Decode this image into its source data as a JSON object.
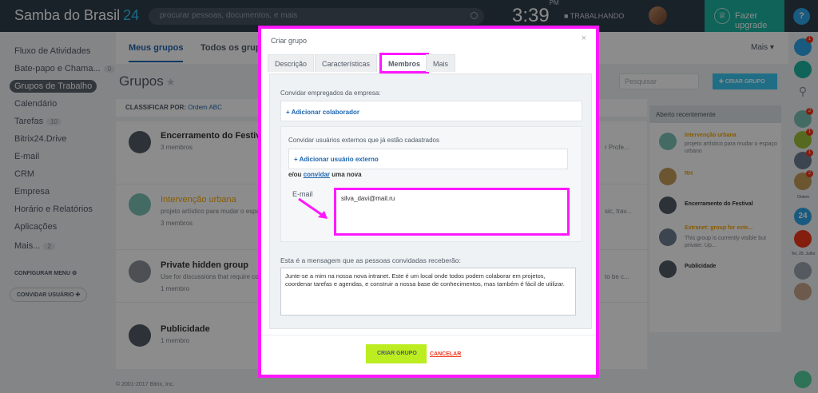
{
  "header": {
    "logo": "Samba do Brasil",
    "logo_number": "24",
    "search_placeholder": "procurar pessoas, documentos, e mais",
    "time": "3:39",
    "time_suffix": "PM",
    "work_status": "TRABALHANDO",
    "upgrade_label": "Fazer upgrade",
    "help": "?"
  },
  "sidebar": {
    "items": [
      {
        "label": "Fluxo de Atividades"
      },
      {
        "label": "Bate-papo e Chama...",
        "count": "0"
      },
      {
        "label": "Grupos de Trabalho"
      },
      {
        "label": "Calendário"
      },
      {
        "label": "Tarefas",
        "count": "10"
      },
      {
        "label": "Bitrix24.Drive"
      },
      {
        "label": "E-mail"
      },
      {
        "label": "CRM"
      },
      {
        "label": "Empresa"
      },
      {
        "label": "Horário e Relatórios"
      },
      {
        "label": "Aplicações"
      },
      {
        "label": "Mais...",
        "count": "2"
      }
    ],
    "configure_menu": "CONFIGURAR MENU",
    "invite_user": "CONVIDAR USUÁRIO"
  },
  "main": {
    "tabs": [
      "Meus grupos",
      "Todos os grupos"
    ],
    "more": "Mais",
    "title": "Grupos",
    "search_placeholder": "Pesquisar",
    "create_group": "CRIAR GRUPO",
    "sort_label": "CLASSIFICAR POR:",
    "sort_value": "Ordem ABC",
    "groups": [
      {
        "name": "Encerramento do Festival",
        "desc": "",
        "meta": "3 membros",
        "trail": "r Profe..."
      },
      {
        "name": "Intervenção urbana",
        "desc": "projeto artístico para mudar o espa",
        "meta": "3 membros",
        "trail": "sic, trav..."
      },
      {
        "name": "Private hidden group",
        "desc": "Use for discussions that require co",
        "meta": "1 membro",
        "trail": "to be c..."
      },
      {
        "name": "Publicidade",
        "desc": "",
        "meta": "1 membro",
        "trail": ""
      }
    ]
  },
  "recent": {
    "heading": "Aberto recentemente",
    "items": [
      {
        "title": "Intervenção urbana",
        "desc": "projeto artístico para mudar o espaço urbano"
      },
      {
        "title": "RH",
        "desc": ""
      },
      {
        "title": "Encerramento do Festival",
        "desc": ""
      },
      {
        "title": "Extranet: group for exte...",
        "desc": "This group is currently visible but private. Up..."
      },
      {
        "title": "Publicidade",
        "desc": ""
      }
    ]
  },
  "rightbar": {
    "labels": [
      "Ontem",
      "Ter, 25. Julho"
    ],
    "calendar_day": "24"
  },
  "modal": {
    "title": "Criar grupo",
    "tabs": [
      "Descrição",
      "Características",
      "Membros",
      "Mais"
    ],
    "invite_employees_label": "Convidar empregados da empresa:",
    "add_collaborator": "Adicionar colaborador",
    "invite_external_label": "Convidar usuários externos que já estão cadastrados",
    "add_external": "Adicionar usuário externo",
    "or_text": "e/ou",
    "invite_link": "convidar",
    "new_text": "uma nova",
    "email_label": "E-mail",
    "email_value": "silva_davi@mail.ru",
    "message_label": "Esta é a mensagem que as pessoas convidadas receberão:",
    "message_text": "Junte-se a mim na nossa nova intranet. Este é um local onde todos podem colaborar em projetos, coordenar tarefas e agendas, e construir a nossa base de conhecimentos, mas também é fácil de utilizar.",
    "create_button": "CRIAR GRUPO",
    "cancel_button": "CANCELAR"
  },
  "footer": {
    "text": "© 2001-2017 Bitrix, Inc."
  }
}
